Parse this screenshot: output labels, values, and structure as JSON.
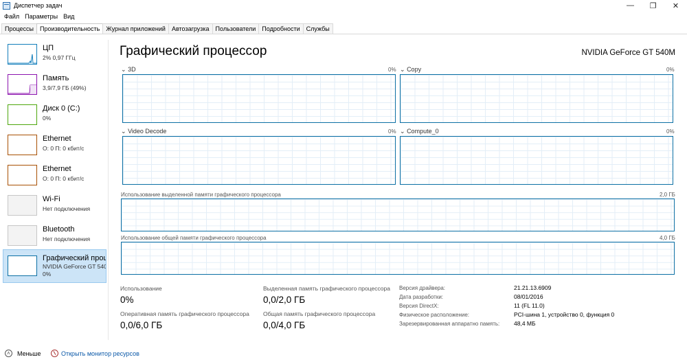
{
  "window": {
    "title": "Диспетчер задач",
    "minimize": "—",
    "maximize": "❐",
    "close": "✕"
  },
  "menu": [
    "Файл",
    "Параметры",
    "Вид"
  ],
  "tabs": [
    "Процессы",
    "Производительность",
    "Журнал приложений",
    "Автозагрузка",
    "Пользователи",
    "Подробности",
    "Службы"
  ],
  "active_tab": "Производительность",
  "sidebar": [
    {
      "name": "ЦП",
      "sub": "2% 0,97 ГГц",
      "color": "#117dbb"
    },
    {
      "name": "Память",
      "sub": "3,9/7,9 ГБ (49%)",
      "color": "#8b12ae"
    },
    {
      "name": "Диск 0 (C:)",
      "sub": "0%",
      "color": "#4da60c"
    },
    {
      "name": "Ethernet",
      "sub": "О: 0 П: 0 кбит/с",
      "color": "#a74f01"
    },
    {
      "name": "Ethernet",
      "sub": "О: 0 П: 0 кбит/с",
      "color": "#a74f01"
    },
    {
      "name": "Wi-Fi",
      "sub": "Нет подключения",
      "color": "#c6c6c6"
    },
    {
      "name": "Bluetooth",
      "sub": "Нет подключения",
      "color": "#c6c6c6"
    },
    {
      "name": "Графический проц",
      "sub": "NVIDIA GeForce GT 540M",
      "sub2": "0%",
      "color": "#0b6fa4"
    }
  ],
  "main": {
    "title": "Графический процессор",
    "model": "NVIDIA GeForce GT 540M",
    "engines": [
      {
        "label": "3D",
        "pct": "0%"
      },
      {
        "label": "Copy",
        "pct": "0%"
      },
      {
        "label": "Video Decode",
        "pct": "0%"
      },
      {
        "label": "Compute_0",
        "pct": "0%"
      }
    ],
    "dedicated_mem": {
      "label": "Использование выделенной памяти графического процессора",
      "max": "2,0 ГБ"
    },
    "shared_mem": {
      "label": "Использование общей памяти графического процессора",
      "max": "4,0 ГБ"
    }
  },
  "stats": {
    "usage": {
      "label": "Использование",
      "value": "0%"
    },
    "gpu_ram": {
      "label": "Оперативная память графического процессора",
      "value": "0,0/6,0 ГБ"
    },
    "dedicated": {
      "label": "Выделенная память графического процессора",
      "value": "0,0/2,0 ГБ"
    },
    "shared": {
      "label": "Общая память графического процессора",
      "value": "0,0/4,0 ГБ"
    }
  },
  "info": [
    {
      "key": "Версия драйвера:",
      "value": "21.21.13.6909"
    },
    {
      "key": "Дата разработки:",
      "value": "08/01/2016"
    },
    {
      "key": "Версия DirectX:",
      "value": "11 (FL 11.0)"
    },
    {
      "key": "Физическое расположение:",
      "value": "PCI-шина 1, устройство 0, функция 0"
    },
    {
      "key": "Зарезервированная аппаратно память:",
      "value": "48,4 МБ"
    }
  ],
  "footer": {
    "less": "Меньше",
    "monitor_link": "Открыть монитор ресурсов"
  }
}
